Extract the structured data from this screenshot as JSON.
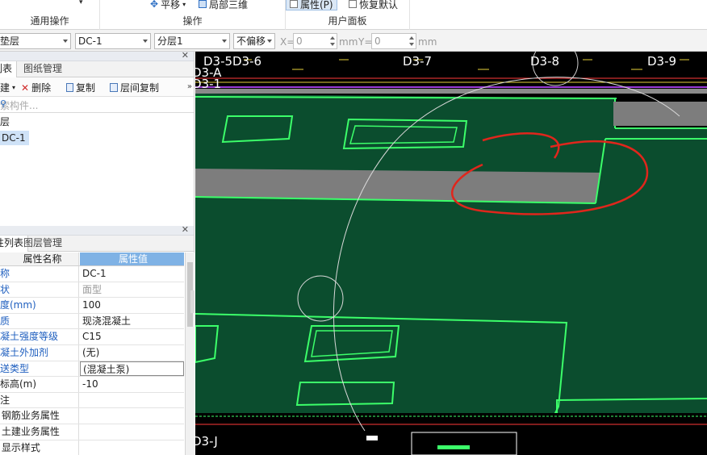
{
  "ribbon": {
    "groups": [
      {
        "label": "通用操作"
      },
      {
        "label": "操作"
      },
      {
        "label": "用户面板"
      }
    ],
    "buttons": {
      "pan": "平移",
      "local_3d": "局部三维",
      "properties": "属性(P)",
      "restore_default": "恢复默认"
    }
  },
  "toolbar": {
    "element_type": "垫层",
    "element_name": "DC-1",
    "floor": "分层1",
    "offset": "不偏移",
    "x_label": "X=",
    "x_value": "0",
    "x_unit": "mm",
    "y_label": "Y=",
    "y_value": "0",
    "y_unit": "mm"
  },
  "component_panel": {
    "tabs": [
      "列表",
      "图纸管理"
    ],
    "actions": {
      "new": "新建",
      "delete": "删除",
      "copy": "复制",
      "floor_copy": "层间复制"
    },
    "search_placeholder": "搜索构件...",
    "tree": {
      "category": "垫层",
      "item": "DC-1"
    }
  },
  "property_panel": {
    "tabs": [
      "属性列表",
      "图层管理"
    ],
    "header": {
      "name": "属性名称",
      "value": "属性值"
    },
    "rows": [
      {
        "name": "名称",
        "value": "DC-1"
      },
      {
        "name": "形状",
        "value": "面型"
      },
      {
        "name": "厚度(mm)",
        "value": "100"
      },
      {
        "name": "材质",
        "value": "现浇混凝土"
      },
      {
        "name": "混凝土强度等级",
        "value": "C15"
      },
      {
        "name": "混凝土外加剂",
        "value": "(无)"
      },
      {
        "name": "泵送类型",
        "value": "(混凝土泵)"
      },
      {
        "name": "顶标高(m)",
        "value": "-10"
      },
      {
        "name": "备注",
        "value": ""
      },
      {
        "name": "+ 钢筋业务属性",
        "value": ""
      },
      {
        "name": "+ 土建业务属性",
        "value": ""
      },
      {
        "name": "+ 显示样式",
        "value": ""
      }
    ]
  },
  "viewport": {
    "axis_labels": [
      "D3-5",
      "D3-6",
      "D3-7",
      "D3-8",
      "D3-9",
      "D3-A",
      "D3-1",
      "D3-J"
    ],
    "colors": {
      "background": "#000000",
      "slab": "#0b4d2e",
      "edge": "#3cff6a",
      "gray_band": "#7d7d7d",
      "markup": "#e0261c"
    }
  }
}
